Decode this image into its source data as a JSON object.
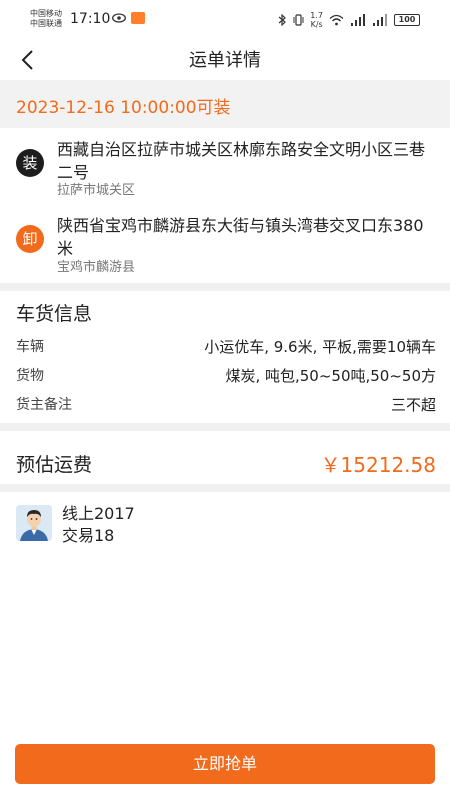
{
  "status_bar": {
    "carrier_1": "中国移动",
    "carrier_2": "中国联通",
    "time": "17:10",
    "net_speed_value": "1.7",
    "net_speed_unit": "K/s",
    "battery": "100"
  },
  "nav": {
    "title": "运单详情"
  },
  "load_time": "2023-12-16 10:00:00可装",
  "loading": {
    "badge": "装",
    "address": "西藏自治区拉萨市城关区林廓东路安全文明小区三巷二号",
    "district": "拉萨市城关区"
  },
  "unloading": {
    "badge": "卸",
    "address": "陕西省宝鸡市麟游县东大街与镇头湾巷交叉口东380米",
    "district": "宝鸡市麟游县"
  },
  "cargo_info": {
    "title": "车货信息",
    "rows": [
      {
        "label": "车辆",
        "value": "小运优车, 9.6米, 平板,需要10辆车"
      },
      {
        "label": "货物",
        "value": "煤炭, 吨包,50~50吨,50~50方"
      },
      {
        "label": "货主备注",
        "value": "三不超"
      }
    ]
  },
  "freight": {
    "label": "预估运费",
    "value": "￥15212.58"
  },
  "shipper": {
    "online_years": "线上2017",
    "trades": "交易18"
  },
  "actions": {
    "grab_label": "立即抢单"
  },
  "colors": {
    "accent": "#f26a1b",
    "banner_bg": "#f2f2f2",
    "separator": "#f0f0f0"
  }
}
